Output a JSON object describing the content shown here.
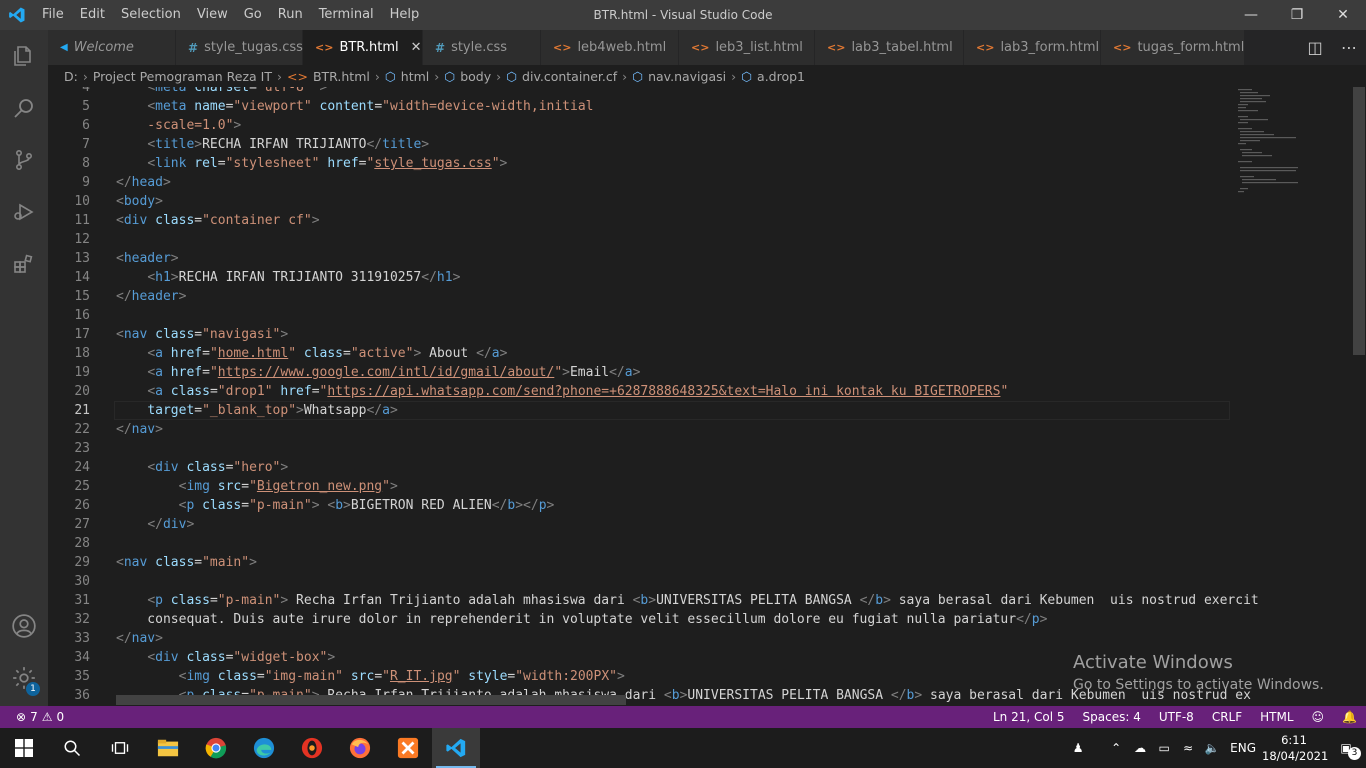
{
  "app": {
    "title": "BTR.html - Visual Studio Code",
    "menu": [
      "File",
      "Edit",
      "Selection",
      "View",
      "Go",
      "Run",
      "Terminal",
      "Help"
    ]
  },
  "tabs": [
    {
      "label": "Welcome",
      "icon": "vscode-icon",
      "italic": true
    },
    {
      "label": "style_tugas.css",
      "icon": "css-icon"
    },
    {
      "label": "BTR.html",
      "icon": "html-icon",
      "active": true
    },
    {
      "label": "style.css",
      "icon": "css-icon"
    },
    {
      "label": "leb4web.html",
      "icon": "html-icon"
    },
    {
      "label": "leb3_list.html",
      "icon": "html-icon"
    },
    {
      "label": "lab3_tabel.html",
      "icon": "html-icon"
    },
    {
      "label": "lab3_form.html",
      "icon": "html-icon"
    },
    {
      "label": "tugas_form.html",
      "icon": "html-icon"
    }
  ],
  "breadcrumbs": [
    "D:",
    "Project Pemograman Reza IT",
    "BTR.html",
    "html",
    "body",
    "div.container.cf",
    "nav.navigasi",
    "a.drop1"
  ],
  "editor": {
    "current_line": "21",
    "lines": [
      {
        "n": "4",
        "segs": [
          [
            "x",
            "    "
          ],
          [
            "p",
            "<"
          ],
          [
            "t",
            "meta"
          ],
          [
            "x",
            " "
          ],
          [
            "a",
            "charset"
          ],
          [
            "x",
            "="
          ],
          [
            "s",
            "\"utf-8\""
          ],
          [
            "x",
            " "
          ],
          [
            "p",
            ">"
          ]
        ]
      },
      {
        "n": "5",
        "segs": [
          [
            "x",
            "    "
          ],
          [
            "p",
            "<"
          ],
          [
            "t",
            "meta"
          ],
          [
            "x",
            " "
          ],
          [
            "a",
            "name"
          ],
          [
            "x",
            "="
          ],
          [
            "s",
            "\"viewport\""
          ],
          [
            "x",
            " "
          ],
          [
            "a",
            "content"
          ],
          [
            "x",
            "="
          ],
          [
            "s",
            "\"width=device-width,initial"
          ]
        ]
      },
      {
        "n": "6",
        "segs": [
          [
            "s",
            "    -scale=1.0\""
          ],
          [
            "p",
            ">"
          ]
        ]
      },
      {
        "n": "7",
        "segs": [
          [
            "x",
            "    "
          ],
          [
            "p",
            "<"
          ],
          [
            "t",
            "title"
          ],
          [
            "p",
            ">"
          ],
          [
            "x",
            "RECHA IRFAN TRIJIANTO"
          ],
          [
            "p",
            "</"
          ],
          [
            "t",
            "title"
          ],
          [
            "p",
            ">"
          ]
        ]
      },
      {
        "n": "8",
        "segs": [
          [
            "x",
            "    "
          ],
          [
            "p",
            "<"
          ],
          [
            "t",
            "link"
          ],
          [
            "x",
            " "
          ],
          [
            "a",
            "rel"
          ],
          [
            "x",
            "="
          ],
          [
            "s",
            "\"stylesheet\""
          ],
          [
            "x",
            " "
          ],
          [
            "a",
            "href"
          ],
          [
            "x",
            "="
          ],
          [
            "s",
            "\""
          ],
          [
            "su",
            "style_tugas.css"
          ],
          [
            "s",
            "\""
          ],
          [
            "p",
            ">"
          ]
        ]
      },
      {
        "n": "9",
        "segs": [
          [
            "p",
            "</"
          ],
          [
            "t",
            "head"
          ],
          [
            "p",
            ">"
          ]
        ]
      },
      {
        "n": "10",
        "segs": [
          [
            "p",
            "<"
          ],
          [
            "t",
            "body"
          ],
          [
            "p",
            ">"
          ]
        ]
      },
      {
        "n": "11",
        "segs": [
          [
            "p",
            "<"
          ],
          [
            "t",
            "div"
          ],
          [
            "x",
            " "
          ],
          [
            "a",
            "class"
          ],
          [
            "x",
            "="
          ],
          [
            "s",
            "\"container cf\""
          ],
          [
            "p",
            ">"
          ]
        ]
      },
      {
        "n": "12",
        "segs": []
      },
      {
        "n": "13",
        "segs": [
          [
            "p",
            "<"
          ],
          [
            "t",
            "header"
          ],
          [
            "p",
            ">"
          ]
        ]
      },
      {
        "n": "14",
        "segs": [
          [
            "x",
            "    "
          ],
          [
            "p",
            "<"
          ],
          [
            "t",
            "h1"
          ],
          [
            "p",
            ">"
          ],
          [
            "x",
            "RECHA IRFAN TRIJIANTO 311910257"
          ],
          [
            "p",
            "</"
          ],
          [
            "t",
            "h1"
          ],
          [
            "p",
            ">"
          ]
        ]
      },
      {
        "n": "15",
        "segs": [
          [
            "p",
            "</"
          ],
          [
            "t",
            "header"
          ],
          [
            "p",
            ">"
          ]
        ]
      },
      {
        "n": "16",
        "segs": []
      },
      {
        "n": "17",
        "segs": [
          [
            "p",
            "<"
          ],
          [
            "t",
            "nav"
          ],
          [
            "x",
            " "
          ],
          [
            "a",
            "class"
          ],
          [
            "x",
            "="
          ],
          [
            "s",
            "\"navigasi\""
          ],
          [
            "p",
            ">"
          ]
        ]
      },
      {
        "n": "18",
        "segs": [
          [
            "x",
            "    "
          ],
          [
            "p",
            "<"
          ],
          [
            "t",
            "a"
          ],
          [
            "x",
            " "
          ],
          [
            "a",
            "href"
          ],
          [
            "x",
            "="
          ],
          [
            "s",
            "\""
          ],
          [
            "su",
            "home.html"
          ],
          [
            "s",
            "\""
          ],
          [
            "x",
            " "
          ],
          [
            "a",
            "class"
          ],
          [
            "x",
            "="
          ],
          [
            "s",
            "\"active\""
          ],
          [
            "p",
            ">"
          ],
          [
            "x",
            " About "
          ],
          [
            "p",
            "</"
          ],
          [
            "t",
            "a"
          ],
          [
            "p",
            ">"
          ]
        ]
      },
      {
        "n": "19",
        "segs": [
          [
            "x",
            "    "
          ],
          [
            "p",
            "<"
          ],
          [
            "t",
            "a"
          ],
          [
            "x",
            " "
          ],
          [
            "a",
            "href"
          ],
          [
            "x",
            "="
          ],
          [
            "s",
            "\""
          ],
          [
            "su",
            "https://www.google.com/intl/id/gmail/about/"
          ],
          [
            "s",
            "\""
          ],
          [
            "p",
            ">"
          ],
          [
            "x",
            "Email"
          ],
          [
            "p",
            "</"
          ],
          [
            "t",
            "a"
          ],
          [
            "p",
            ">"
          ]
        ]
      },
      {
        "n": "20",
        "segs": [
          [
            "x",
            "    "
          ],
          [
            "p",
            "<"
          ],
          [
            "t",
            "a"
          ],
          [
            "x",
            " "
          ],
          [
            "a",
            "class"
          ],
          [
            "x",
            "="
          ],
          [
            "s",
            "\"drop1\""
          ],
          [
            "x",
            " "
          ],
          [
            "a",
            "href"
          ],
          [
            "x",
            "="
          ],
          [
            "s",
            "\""
          ],
          [
            "su",
            "https://api.whatsapp.com/send?phone=+6287888648325&text=Halo ini kontak ku BIGETROPERS"
          ],
          [
            "s",
            "\""
          ]
        ]
      },
      {
        "n": "21",
        "segs": [
          [
            "x",
            "    "
          ],
          [
            "a",
            "target"
          ],
          [
            "x",
            "="
          ],
          [
            "s",
            "\"_blank_top\""
          ],
          [
            "p",
            ">"
          ],
          [
            "x",
            "Whatsapp"
          ],
          [
            "p",
            "</"
          ],
          [
            "t",
            "a"
          ],
          [
            "p",
            ">"
          ]
        ]
      },
      {
        "n": "22",
        "segs": [
          [
            "p",
            "</"
          ],
          [
            "t",
            "nav"
          ],
          [
            "p",
            ">"
          ]
        ]
      },
      {
        "n": "23",
        "segs": []
      },
      {
        "n": "24",
        "segs": [
          [
            "x",
            "    "
          ],
          [
            "p",
            "<"
          ],
          [
            "t",
            "div"
          ],
          [
            "x",
            " "
          ],
          [
            "a",
            "class"
          ],
          [
            "x",
            "="
          ],
          [
            "s",
            "\"hero\""
          ],
          [
            "p",
            ">"
          ]
        ]
      },
      {
        "n": "25",
        "segs": [
          [
            "x",
            "        "
          ],
          [
            "p",
            "<"
          ],
          [
            "t",
            "img"
          ],
          [
            "x",
            " "
          ],
          [
            "a",
            "src"
          ],
          [
            "x",
            "="
          ],
          [
            "s",
            "\""
          ],
          [
            "su",
            "Bigetron_new.png"
          ],
          [
            "s",
            "\""
          ],
          [
            "p",
            ">"
          ]
        ]
      },
      {
        "n": "26",
        "segs": [
          [
            "x",
            "        "
          ],
          [
            "p",
            "<"
          ],
          [
            "t",
            "p"
          ],
          [
            "x",
            " "
          ],
          [
            "a",
            "class"
          ],
          [
            "x",
            "="
          ],
          [
            "s",
            "\"p-main\""
          ],
          [
            "p",
            ">"
          ],
          [
            "x",
            " "
          ],
          [
            "p",
            "<"
          ],
          [
            "t",
            "b"
          ],
          [
            "p",
            ">"
          ],
          [
            "x",
            "BIGETRON RED ALIEN"
          ],
          [
            "p",
            "</"
          ],
          [
            "t",
            "b"
          ],
          [
            "p",
            "></"
          ],
          [
            "t",
            "p"
          ],
          [
            "p",
            ">"
          ]
        ]
      },
      {
        "n": "27",
        "segs": [
          [
            "x",
            "    "
          ],
          [
            "p",
            "</"
          ],
          [
            "t",
            "div"
          ],
          [
            "p",
            ">"
          ]
        ]
      },
      {
        "n": "28",
        "segs": []
      },
      {
        "n": "29",
        "segs": [
          [
            "p",
            "<"
          ],
          [
            "t",
            "nav"
          ],
          [
            "x",
            " "
          ],
          [
            "a",
            "class"
          ],
          [
            "x",
            "="
          ],
          [
            "s",
            "\"main\""
          ],
          [
            "p",
            ">"
          ]
        ]
      },
      {
        "n": "30",
        "segs": []
      },
      {
        "n": "31",
        "segs": [
          [
            "x",
            "    "
          ],
          [
            "p",
            "<"
          ],
          [
            "t",
            "p"
          ],
          [
            "x",
            " "
          ],
          [
            "a",
            "class"
          ],
          [
            "x",
            "="
          ],
          [
            "s",
            "\"p-main\""
          ],
          [
            "p",
            ">"
          ],
          [
            "x",
            " Recha Irfan Trijianto adalah mhasiswa dari "
          ],
          [
            "p",
            "<"
          ],
          [
            "t",
            "b"
          ],
          [
            "p",
            ">"
          ],
          [
            "x",
            "UNIVERSITAS PELITA BANGSA "
          ],
          [
            "p",
            "</"
          ],
          [
            "t",
            "b"
          ],
          [
            "p",
            ">"
          ],
          [
            "x",
            " saya berasal dari Kebumen  uis nostrud exercit"
          ]
        ]
      },
      {
        "n": "32",
        "segs": [
          [
            "x",
            "    consequat. Duis aute irure dolor in reprehenderit in voluptate velit essecillum dolore eu fugiat nulla pariatur"
          ],
          [
            "p",
            "</"
          ],
          [
            "t",
            "p"
          ],
          [
            "p",
            ">"
          ]
        ]
      },
      {
        "n": "33",
        "segs": [
          [
            "p",
            "</"
          ],
          [
            "t",
            "nav"
          ],
          [
            "p",
            ">"
          ]
        ]
      },
      {
        "n": "34",
        "segs": [
          [
            "x",
            "    "
          ],
          [
            "p",
            "<"
          ],
          [
            "t",
            "div"
          ],
          [
            "x",
            " "
          ],
          [
            "a",
            "class"
          ],
          [
            "x",
            "="
          ],
          [
            "s",
            "\"widget-box\""
          ],
          [
            "p",
            ">"
          ]
        ]
      },
      {
        "n": "35",
        "segs": [
          [
            "x",
            "        "
          ],
          [
            "p",
            "<"
          ],
          [
            "t",
            "img"
          ],
          [
            "x",
            " "
          ],
          [
            "a",
            "class"
          ],
          [
            "x",
            "="
          ],
          [
            "s",
            "\"img-main\""
          ],
          [
            "x",
            " "
          ],
          [
            "a",
            "src"
          ],
          [
            "x",
            "="
          ],
          [
            "s",
            "\""
          ],
          [
            "su",
            "R_IT.jpg"
          ],
          [
            "s",
            "\""
          ],
          [
            "x",
            " "
          ],
          [
            "a",
            "style"
          ],
          [
            "x",
            "="
          ],
          [
            "s",
            "\"width:200PX\""
          ],
          [
            "p",
            ">"
          ]
        ]
      },
      {
        "n": "36",
        "segs": [
          [
            "x",
            "        "
          ],
          [
            "p",
            "<"
          ],
          [
            "t",
            "p"
          ],
          [
            "x",
            " "
          ],
          [
            "a",
            "class"
          ],
          [
            "x",
            "="
          ],
          [
            "s",
            "\"p-main\""
          ],
          [
            "p",
            ">"
          ],
          [
            "x",
            " Recha Irfan Trijianto adalah mhasiswa dari "
          ],
          [
            "p",
            "<"
          ],
          [
            "t",
            "b"
          ],
          [
            "p",
            ">"
          ],
          [
            "x",
            "UNIVERSITAS PELITA BANGSA "
          ],
          [
            "p",
            "</"
          ],
          [
            "t",
            "b"
          ],
          [
            "p",
            ">"
          ],
          [
            "x",
            " saya berasal dari Kebumen  uis nostrud ex"
          ]
        ]
      }
    ]
  },
  "watermark": {
    "title": "Activate Windows",
    "subtitle": "Go to Settings to activate Windows."
  },
  "status": {
    "errors": "7",
    "warnings": "0",
    "position": "Ln 21, Col 5",
    "spaces": "Spaces: 4",
    "encoding": "UTF-8",
    "eol": "CRLF",
    "language": "HTML"
  },
  "taskbar": {
    "lang": "ENG",
    "time": "6:11",
    "date": "18/04/2021",
    "notifications": "3",
    "apps": [
      "file-explorer",
      "chrome",
      "edge",
      "opera",
      "firefox",
      "xampp",
      "vscode"
    ]
  },
  "accent_colors": {
    "statusbar": "#68217a",
    "activity_badge": "#0e639c"
  }
}
